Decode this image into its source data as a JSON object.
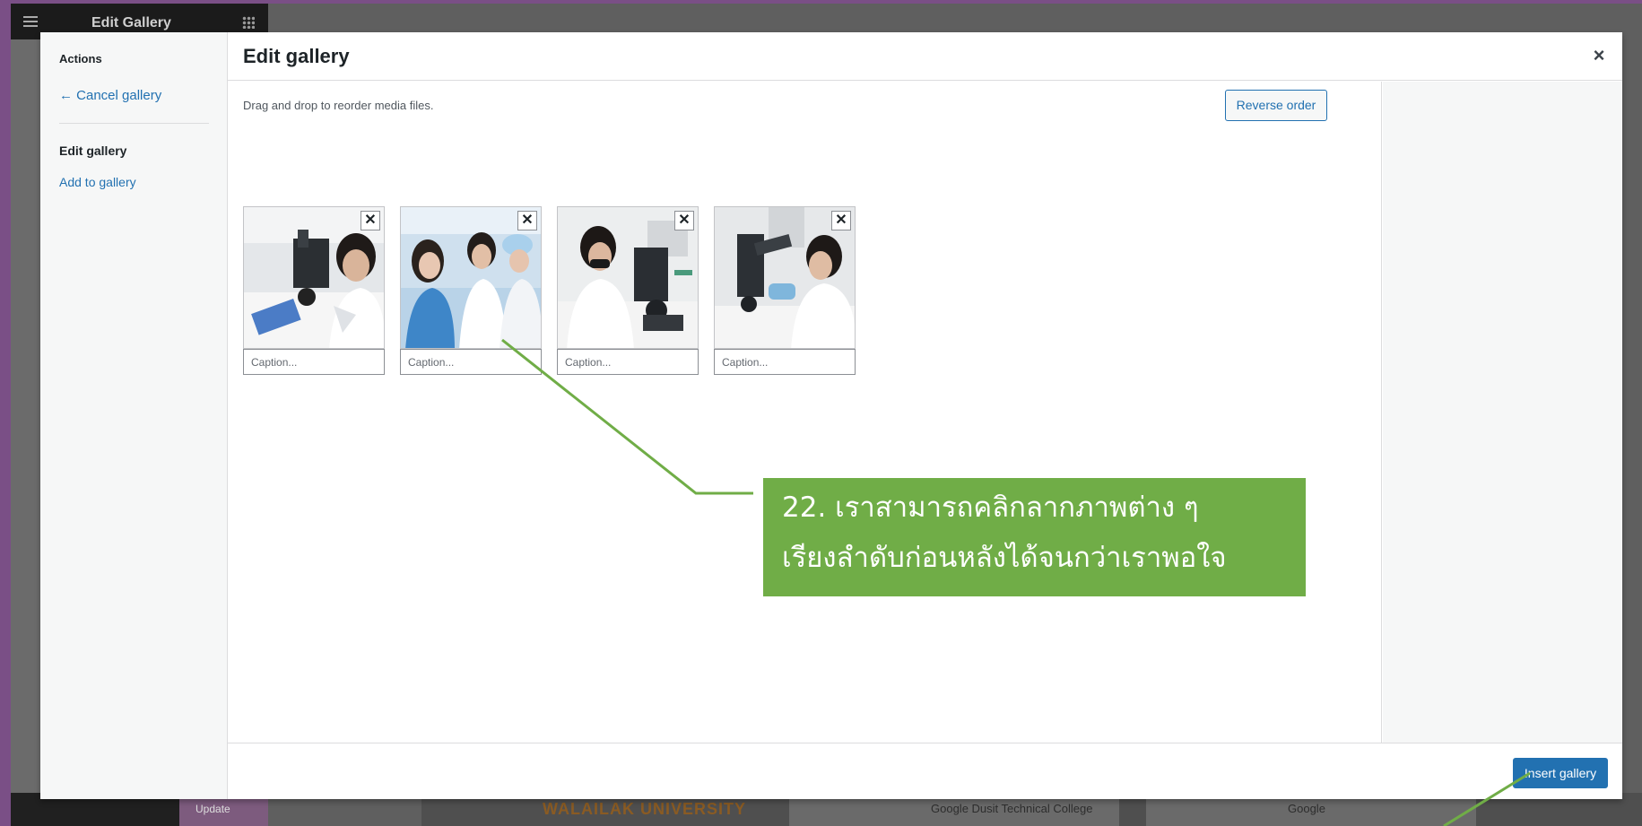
{
  "background": {
    "editor_title": "Edit Gallery",
    "update_label": "Update",
    "footer_logo_text": "WALAILAK UNIVERSITY",
    "map_label_1": "Google  Dusit Technical College",
    "map_label_2": "Google"
  },
  "modal": {
    "menu": {
      "heading": "Actions",
      "cancel_link": "← Cancel gallery",
      "edit_label": "Edit gallery",
      "add_link": "Add to gallery"
    },
    "title": "Edit gallery",
    "close_label": "×",
    "instructions": "Drag and drop to reorder media files.",
    "reverse_button": "Reverse order",
    "items": [
      {
        "caption_placeholder": "Caption...",
        "remove_label": "✕",
        "photo_icon": "lab-microscope-photo"
      },
      {
        "caption_placeholder": "Caption...",
        "remove_label": "✕",
        "photo_icon": "lab-group-photo"
      },
      {
        "caption_placeholder": "Caption...",
        "remove_label": "✕",
        "photo_icon": "lab-mask-microscope-photo"
      },
      {
        "caption_placeholder": "Caption...",
        "remove_label": "✕",
        "photo_icon": "lab-closeup-microscope-photo"
      }
    ],
    "insert_button": "Insert gallery"
  },
  "annotation": {
    "line1": "22. เราสามารถคลิกลากภาพต่าง ๆ",
    "line2": "เรียงลำดับก่อนหลังได้จนกว่าเราพอใจ",
    "color": "#70ad47"
  }
}
